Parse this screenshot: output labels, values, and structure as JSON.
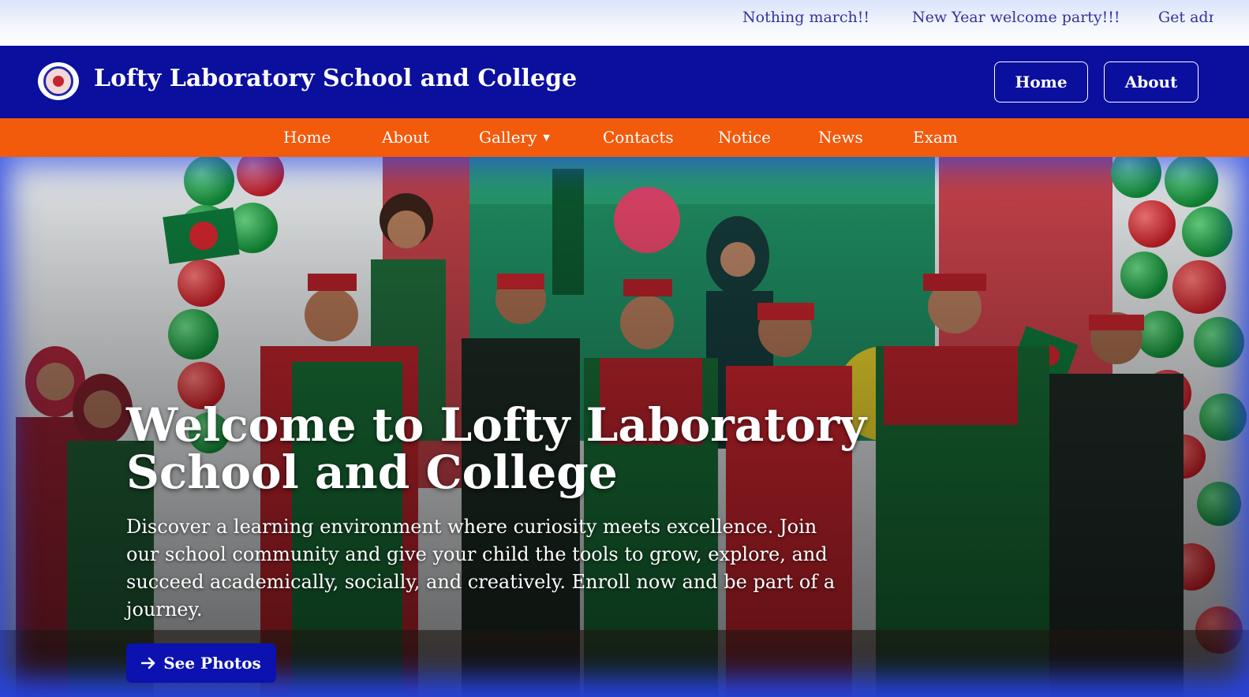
{
  "ticker": {
    "items": [
      "Nothing march!!",
      "New Year welcome party!!!",
      "Get adm"
    ]
  },
  "header": {
    "logo_icon": "school-crest-icon",
    "title": "Lofty Laboratory School and College",
    "buttons": {
      "home": "Home",
      "about": "About"
    }
  },
  "nav": {
    "items": [
      "Home",
      "About",
      "Gallery",
      "Contacts",
      "Notice",
      "News",
      "Exam"
    ],
    "dropdown_icon": "caret-down-icon"
  },
  "hero": {
    "title_line1": "Welcome to Lofty Laboratory",
    "title_line2": "School and College",
    "description": "Discover a learning environment where curiosity meets excellence. Join our school community and give your child the tools to grow, explore, and succeed academically, socially, and creatively. Enroll now and be part of a journey.",
    "cta_label": "See Photos",
    "cta_icon": "arrow-right-icon"
  },
  "colors": {
    "header_bg": "#0a0f9e",
    "nav_bg": "#f25a0c",
    "ticker_text": "#34349a",
    "cta_bg": "#0b12b0"
  }
}
